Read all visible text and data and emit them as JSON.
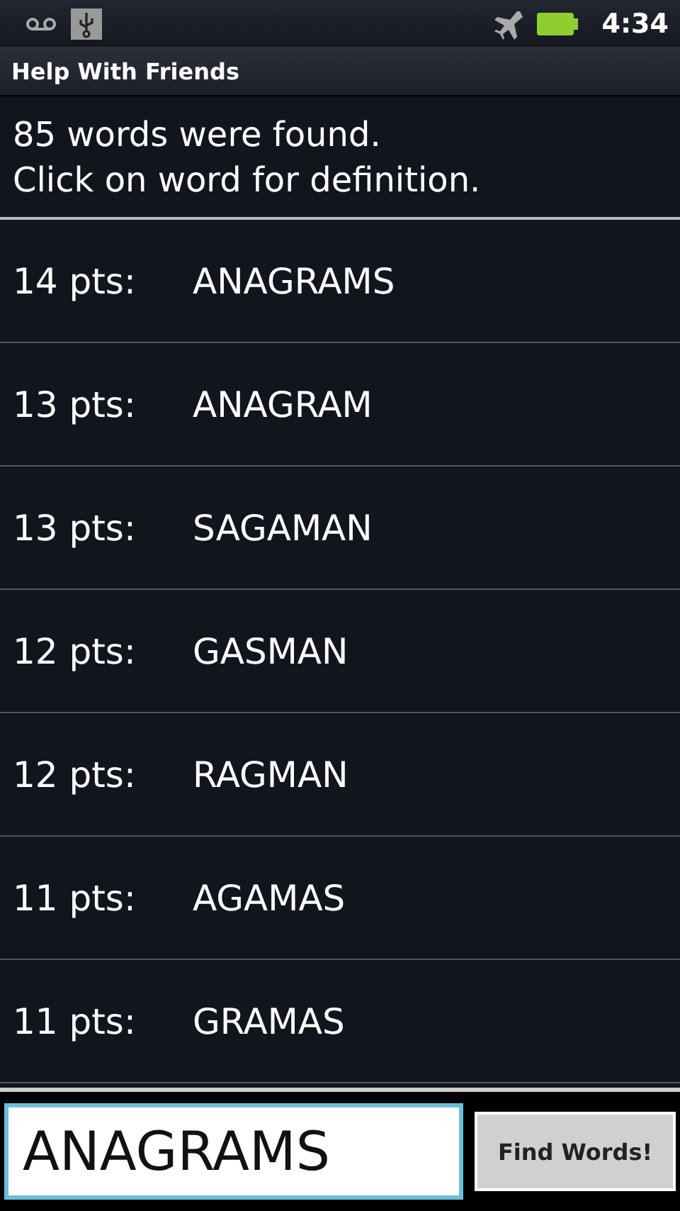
{
  "status_bar": {
    "time": "4:34"
  },
  "window": {
    "title": "Help With Friends"
  },
  "message": [
    "85 words were found.",
    "Click on word for definition."
  ],
  "words": [
    {
      "points": "14 pts:",
      "word": "ANAGRAMS"
    },
    {
      "points": "13 pts:",
      "word": "ANAGRAM"
    },
    {
      "points": "13 pts:",
      "word": "SAGAMAN"
    },
    {
      "points": "12 pts:",
      "word": "GASMAN"
    },
    {
      "points": "12 pts:",
      "word": "RAGMAN"
    },
    {
      "points": "11 pts:",
      "word": "AGAMAS"
    },
    {
      "points": "11 pts:",
      "word": "GRAMAS"
    }
  ],
  "search": {
    "value": "ANAGRAMS"
  },
  "buttons": [
    "Find Words!"
  ]
}
